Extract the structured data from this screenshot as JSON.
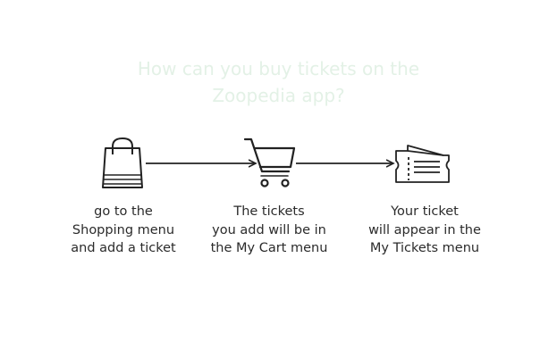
{
  "title": {
    "line1": "How can you buy tickets on the",
    "line2": "Zoopedia app?"
  },
  "colors": {
    "title": "#e3f1e6",
    "text": "#2b2b2b",
    "stroke": "#222222"
  },
  "steps": [
    {
      "icon": "shopping-bag-icon",
      "lines": [
        "go to the",
        "Shopping menu",
        "and add a ticket"
      ]
    },
    {
      "icon": "shopping-cart-icon",
      "lines": [
        "The tickets",
        "you add will be in",
        "the My Cart menu"
      ]
    },
    {
      "icon": "ticket-icon",
      "lines": [
        "Your ticket",
        "will appear in the",
        "My Tickets menu"
      ]
    }
  ]
}
